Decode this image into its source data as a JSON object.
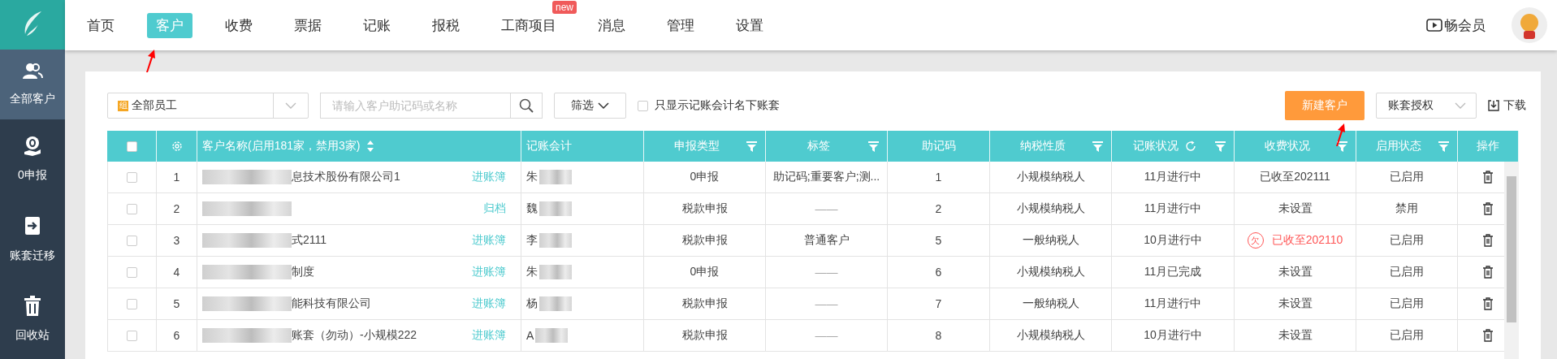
{
  "nav": [
    {
      "label": "首页",
      "selected": false
    },
    {
      "label": "客户",
      "selected": true
    },
    {
      "label": "收费",
      "selected": false
    },
    {
      "label": "票据",
      "selected": false
    },
    {
      "label": "记账",
      "selected": false
    },
    {
      "label": "报税",
      "selected": false
    },
    {
      "label": "工商项目",
      "selected": false,
      "badge": "new"
    },
    {
      "label": "消息",
      "selected": false
    },
    {
      "label": "管理",
      "selected": false
    },
    {
      "label": "设置",
      "selected": false
    }
  ],
  "member_link": "畅会员",
  "sidebar": [
    {
      "kind": "people",
      "label": "全部客户",
      "selected": true
    },
    {
      "kind": "zero",
      "label": "0申报",
      "selected": false
    },
    {
      "kind": "migrate",
      "label": "账套迁移",
      "selected": false
    },
    {
      "kind": "trash",
      "label": "回收站",
      "selected": false
    }
  ],
  "toolbar": {
    "staff_select": {
      "badge": "组",
      "value": "全部员工"
    },
    "search": {
      "placeholder": "请输入客户助记码或名称"
    },
    "filter_button": "筛选",
    "only_mine": {
      "label": "只显示记账会计名下账套",
      "checked": false
    },
    "new_button": "新建客户",
    "auth_select": "账套授权",
    "download": "下载"
  },
  "table": {
    "select_all": false,
    "columns": [
      {
        "label": "客户名称(启用181家，禁用3家)",
        "kind": "sort"
      },
      {
        "label": "记账会计",
        "kind": "plain"
      },
      {
        "label": "申报类型",
        "kind": "filter"
      },
      {
        "label": "标签",
        "kind": "filter"
      },
      {
        "label": "助记码",
        "kind": "plain"
      },
      {
        "label": "纳税性质",
        "kind": "filter"
      },
      {
        "label": "记账状况",
        "kind": "refresh-filter"
      },
      {
        "label": "收费状况",
        "kind": "filter"
      },
      {
        "label": "启用状态",
        "kind": "filter"
      },
      {
        "label": "操作",
        "kind": "plain"
      }
    ],
    "rows": [
      {
        "checked": false,
        "index": "1",
        "name": "息技术股份有限公司1",
        "action": "进账簿",
        "accountant": "朱",
        "report_type": "0申报",
        "tag": "助记码;重要客户;测...",
        "code": "1",
        "tax_type": "小规模纳税人",
        "book_status": "11月进行中",
        "fee_status": "已收至202111",
        "fee_overdue": false,
        "enabled_status": "已启用"
      },
      {
        "checked": false,
        "index": "2",
        "name": "",
        "action": "归档",
        "accountant": "魏",
        "report_type": "税款申报",
        "tag": "——",
        "code": "2",
        "tax_type": "小规模纳税人",
        "book_status": "11月进行中",
        "fee_status": "未设置",
        "fee_overdue": false,
        "enabled_status": "禁用"
      },
      {
        "checked": false,
        "index": "3",
        "name": "式2111",
        "action": "进账簿",
        "accountant": "李",
        "report_type": "税款申报",
        "tag": "普通客户",
        "code": "5",
        "tax_type": "一般纳税人",
        "book_status": "10月进行中",
        "fee_status": "已收至202110",
        "fee_overdue": true,
        "overdue_mark": "欠",
        "enabled_status": "已启用"
      },
      {
        "checked": false,
        "index": "4",
        "name": "制度",
        "action": "进账簿",
        "accountant": "朱",
        "report_type": "0申报",
        "tag": "——",
        "code": "6",
        "tax_type": "小规模纳税人",
        "book_status": "11月已完成",
        "fee_status": "未设置",
        "fee_overdue": false,
        "enabled_status": "已启用"
      },
      {
        "checked": false,
        "index": "5",
        "name": "能科技有限公司",
        "action": "进账簿",
        "accountant": "杨",
        "report_type": "税款申报",
        "tag": "——",
        "code": "7",
        "tax_type": "一般纳税人",
        "book_status": "11月进行中",
        "fee_status": "未设置",
        "fee_overdue": false,
        "enabled_status": "已启用"
      },
      {
        "checked": false,
        "index": "6",
        "name": "账套（勿动）-小规模222",
        "action": "进账簿",
        "accountant": "A",
        "report_type": "税款申报",
        "tag": "——",
        "code": "8",
        "tax_type": "小规模纳税人",
        "book_status": "10月进行中",
        "fee_status": "未设置",
        "fee_overdue": false,
        "enabled_status": "已启用"
      }
    ]
  }
}
